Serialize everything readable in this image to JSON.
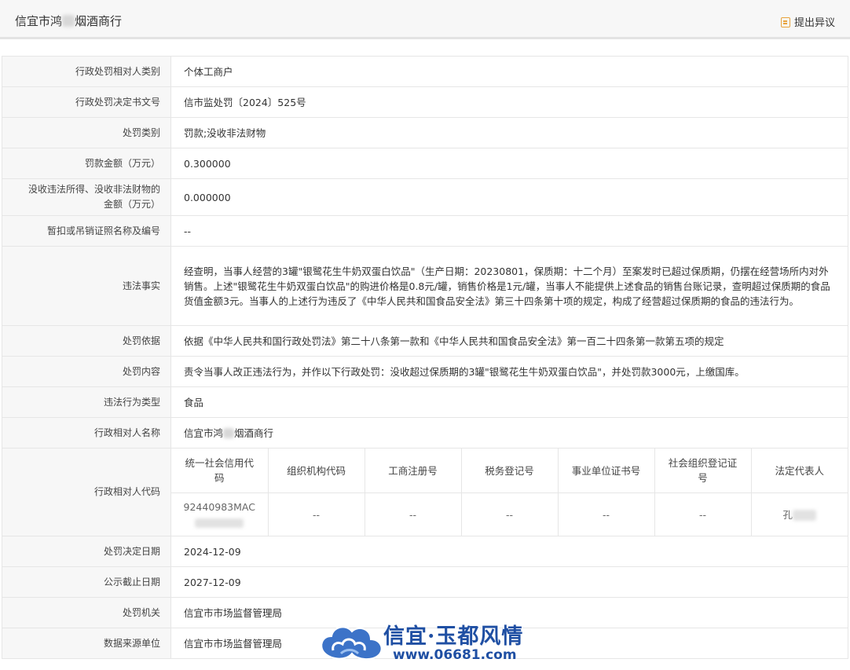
{
  "header": {
    "title_part1": "信宜市鸿",
    "title_part2": "烟酒商行",
    "objection_label": "提出异议"
  },
  "rows": {
    "party_type": {
      "label": "行政处罚相对人类别",
      "value": "个体工商户"
    },
    "decision_no": {
      "label": "行政处罚决定书文号",
      "value": "信市监处罚〔2024〕525号"
    },
    "penalty_type": {
      "label": "处罚类别",
      "value": "罚款;没收非法财物"
    },
    "fine": {
      "label": "罚款金额（万元）",
      "value": "0.300000"
    },
    "confiscation": {
      "label_line1": "没收违法所得、没收非法财物的",
      "label_line2": "金额（万元）",
      "value": "0.000000"
    },
    "license": {
      "label": "暂扣或吊销证照名称及编号",
      "value": "--"
    },
    "facts": {
      "label": "违法事实",
      "value": "经查明，当事人经营的3罐\"银鹭花生牛奶双蛋白饮品\"（生产日期：20230801，保质期：十二个月）至案发时已超过保质期，仍摆在经营场所内对外销售。上述\"银鹭花生牛奶双蛋白饮品\"的购进价格是0.8元/罐，销售价格是1元/罐，当事人不能提供上述食品的销售台账记录，查明超过保质期的食品货值金额3元。当事人的上述行为违反了《中华人民共和国食品安全法》第三十四条第十项的规定，构成了经营超过保质期的食品的违法行为。"
    },
    "basis": {
      "label": "处罚依据",
      "value": "依据《中华人民共和国行政处罚法》第二十八条第一款和《中华人民共和国食品安全法》第一百二十四条第一款第五项的规定"
    },
    "content": {
      "label": "处罚内容",
      "value": "责令当事人改正违法行为，并作以下行政处罚：没收超过保质期的3罐\"银鹭花生牛奶双蛋白饮品\"，并处罚款3000元，上缴国库。"
    },
    "violation_type": {
      "label": "违法行为类型",
      "value": "食品"
    },
    "party_name": {
      "label": "行政相对人名称",
      "value_part1": "信宜市鸿",
      "value_part2": "烟酒商行"
    },
    "party_code": {
      "label": "行政相对人代码",
      "headers": [
        "统一社会信用代码",
        "组织机构代码",
        "工商注册号",
        "税务登记号",
        "事业单位证书号",
        "社会组织登记证号",
        "法定代表人"
      ],
      "credit_code": "92440983MAC",
      "org_code": "--",
      "biz_reg": "--",
      "tax_reg": "--",
      "inst_cert": "--",
      "social_cert": "--",
      "legal_rep": "孔"
    },
    "decision_date": {
      "label": "处罚决定日期",
      "value": "2024-12-09"
    },
    "expiry_date": {
      "label": "公示截止日期",
      "value": "2027-12-09"
    },
    "authority": {
      "label": "处罚机关",
      "value": "信宜市市场监督管理局"
    },
    "source": {
      "label": "数据来源单位",
      "value": "信宜市市场监督管理局"
    }
  },
  "watermark": {
    "name": "信宜·玉都风情",
    "url": "www.06681.com"
  },
  "colors": {
    "label_bg": "#f7f7f7",
    "border": "#e6e6e6",
    "accent_icon": "#e8a33c",
    "watermark": "#1f4fa3"
  }
}
